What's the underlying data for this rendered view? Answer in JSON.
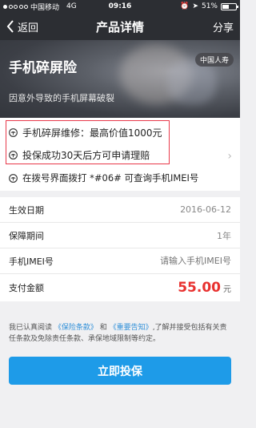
{
  "status_bar": {
    "carrier": "中国移动",
    "network": "4G",
    "time": "09:16",
    "battery": "51%",
    "battery_level": 0.51
  },
  "nav": {
    "back_label": "返回",
    "title": "产品详情",
    "share_label": "分享"
  },
  "hero": {
    "title": "手机碎屏险",
    "subtitle": "因意外导致的手机屏幕破裂",
    "insurer_tag": "中国人寿"
  },
  "features": [
    "手机碎屏维修：最高价值1000元",
    "投保成功30天后方可申请理赔",
    "在拨号界面拨打 *#06# 可查询手机IMEI号"
  ],
  "details": {
    "effective_date_label": "生效日期",
    "effective_date_value": "2016-06-12",
    "period_label": "保障期间",
    "period_value": "1年",
    "imei_label": "手机IMEI号",
    "imei_placeholder": "请输入手机IMEI号",
    "payment_label": "支付金额",
    "payment_amount": "55.00",
    "payment_unit": "元"
  },
  "agreement": {
    "prefix": "我已认真阅读",
    "terms_link": "《保险条款》",
    "and": "和",
    "notice_link": "《重要告知》",
    "suffix": ",了解并接受包括有关责任条款及免除责任条款、承保地域限制等约定。"
  },
  "buy_button_label": "立即投保",
  "colors": {
    "nav_bg": "#2c2e33",
    "accent_blue": "#1e9be8",
    "price_red": "#e8312f",
    "highlight_red": "#e8394a"
  }
}
